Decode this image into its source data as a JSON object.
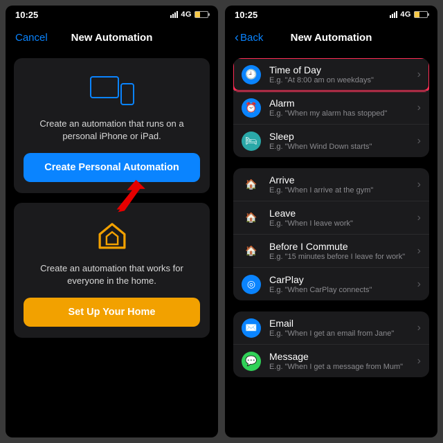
{
  "status": {
    "time": "10:25",
    "network": "4G"
  },
  "left": {
    "cancel": "Cancel",
    "title": "New Automation",
    "personal": {
      "desc": "Create an automation that runs on a personal iPhone or iPad.",
      "button": "Create Personal Automation"
    },
    "home": {
      "desc": "Create an automation that works for everyone in the home.",
      "button": "Set Up Your Home"
    }
  },
  "right": {
    "back": "Back",
    "title": "New Automation",
    "groups": [
      {
        "items": [
          {
            "icon": "clock",
            "title": "Time of Day",
            "sub": "E.g. \"At 8:00 am on weekdays\"",
            "highlight": true
          },
          {
            "icon": "alarm",
            "title": "Alarm",
            "sub": "E.g. \"When my alarm has stopped\""
          },
          {
            "icon": "bed",
            "title": "Sleep",
            "sub": "E.g. \"When Wind Down starts\""
          }
        ]
      },
      {
        "items": [
          {
            "icon": "arrive",
            "title": "Arrive",
            "sub": "E.g. \"When I arrive at the gym\""
          },
          {
            "icon": "leave",
            "title": "Leave",
            "sub": "E.g. \"When I leave work\""
          },
          {
            "icon": "commute",
            "title": "Before I Commute",
            "sub": "E.g. \"15 minutes before I leave for work\""
          },
          {
            "icon": "carplay",
            "title": "CarPlay",
            "sub": "E.g. \"When CarPlay connects\""
          }
        ]
      },
      {
        "items": [
          {
            "icon": "email",
            "title": "Email",
            "sub": "E.g. \"When I get an email from Jane\""
          },
          {
            "icon": "message",
            "title": "Message",
            "sub": "E.g. \"When I get a message from Mum\""
          }
        ]
      }
    ]
  }
}
